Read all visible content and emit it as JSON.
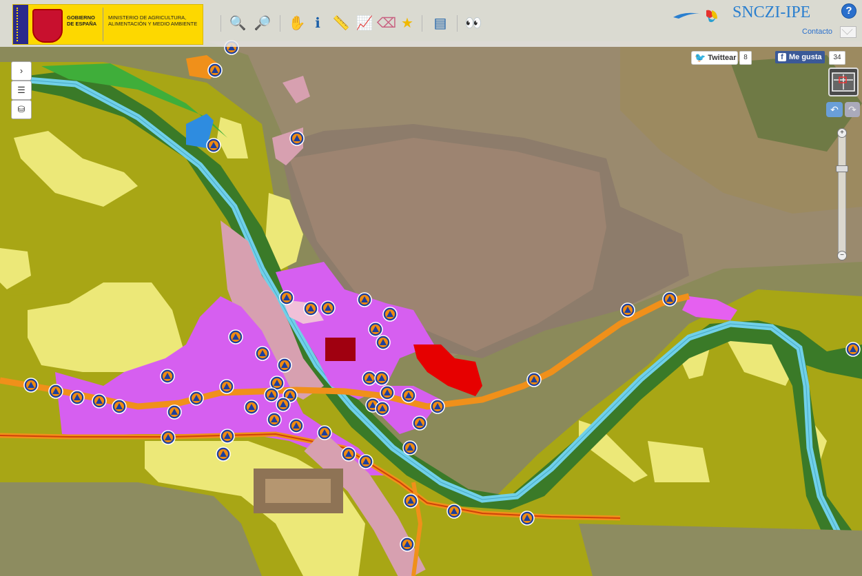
{
  "header": {
    "gov_line1": "GOBIERNO DE ESPAÑA",
    "gov_line2": "MINISTERIO DE AGRICULTURA, ALIMENTACIÓN Y MEDIO AMBIENTE",
    "app_title": "SNCZI-IPE",
    "help_label": "?",
    "contact_label": "Contacto"
  },
  "toolbar": {
    "tools": [
      {
        "icon": "zoom-in-icon",
        "glyph": "🔍"
      },
      {
        "icon": "zoom-out-icon",
        "glyph": "🔎"
      },
      {
        "icon": "pan-hand-icon",
        "glyph": "✋"
      },
      {
        "icon": "info-icon",
        "glyph": "ℹ"
      },
      {
        "icon": "measure-ruler-icon",
        "glyph": "📏"
      },
      {
        "icon": "profile-chart-icon",
        "glyph": "📈"
      },
      {
        "icon": "eraser-icon",
        "glyph": "⌫"
      },
      {
        "icon": "favorites-star-icon",
        "glyph": "★"
      },
      {
        "icon": "legend-icon",
        "glyph": "▤"
      },
      {
        "icon": "binoculars-icon",
        "glyph": "👀"
      }
    ]
  },
  "social": {
    "twitter_label": "Twittear",
    "twitter_count": "8",
    "facebook_label": "Me gusta",
    "facebook_count": "34"
  },
  "map_controls": {
    "expand_glyph": "›",
    "layers_glyph": "☰",
    "basemap_glyph": "⛁",
    "undo_glyph": "↶",
    "redo_glyph": "↷",
    "zoom_in": "+",
    "zoom_out": "−"
  },
  "map_colors": {
    "residential_urban": "#d65ff0",
    "industrial": "#e8a0c0",
    "agricultural": "#a8a615",
    "green_areas": "#3a7a28",
    "river": "#70d0e8",
    "roads": "#f0901a",
    "flood_zone": "#e8e070",
    "critical_area": "#e60000"
  },
  "markers_label": "civil-protection-markers"
}
